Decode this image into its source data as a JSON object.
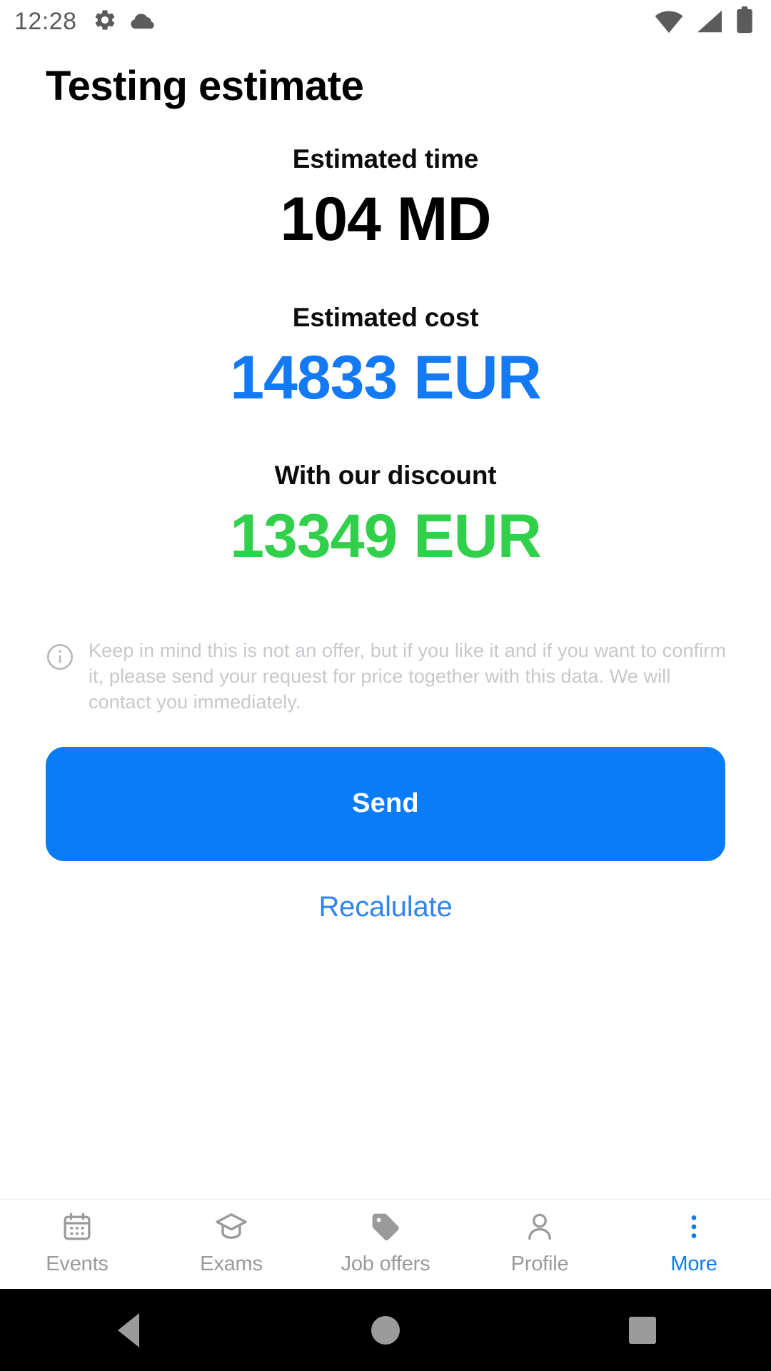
{
  "status_bar": {
    "time": "12:28",
    "left_icons": [
      "gear-icon",
      "cloud-icon"
    ],
    "right_icons": [
      "wifi-icon",
      "cellular-signal-icon",
      "battery-icon"
    ]
  },
  "header": {
    "title": "Testing estimate"
  },
  "metrics": [
    {
      "label": "Estimated time",
      "value": "104 MD",
      "color": "#000000"
    },
    {
      "label": "Estimated cost",
      "value": "14833 EUR",
      "color": "#1479f5"
    },
    {
      "label": "With our discount",
      "value": "13349 EUR",
      "color": "#31d04a"
    }
  ],
  "disclaimer": {
    "icon": "info-circle-icon",
    "text": "Keep in mind this is not an offer, but if you like it and if you want to confirm it, please send your request for price together with this data. We will contact you immediately."
  },
  "actions": {
    "send_label": "Send",
    "recalculate_label": "Recalulate"
  },
  "tabbar": {
    "items": [
      {
        "label": "Events",
        "icon": "calendar-icon",
        "active": false
      },
      {
        "label": "Exams",
        "icon": "graduation-cap-icon",
        "active": false
      },
      {
        "label": "Job offers",
        "icon": "tag-icon",
        "active": false
      },
      {
        "label": "Profile",
        "icon": "person-icon",
        "active": false
      },
      {
        "label": "More",
        "icon": "more-vertical-icon",
        "active": true
      }
    ]
  },
  "nav_bar": {
    "buttons": [
      "back-button",
      "home-button",
      "recents-button"
    ]
  },
  "colors": {
    "accent_blue": "#1479f5",
    "button_blue": "#0a7cf7",
    "success_green": "#31d04a",
    "muted_grey": "#c6c8cb"
  }
}
